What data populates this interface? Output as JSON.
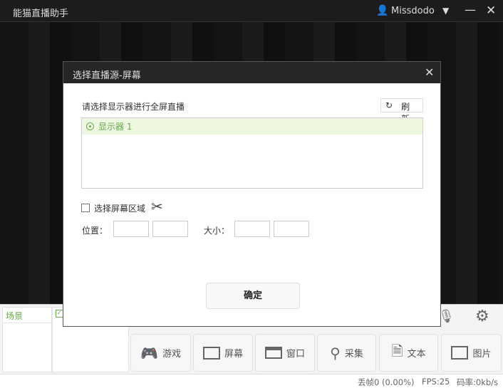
{
  "app": {
    "title": "能猫直播助手",
    "username": "Missdodo"
  },
  "scenes": {
    "header": "场景"
  },
  "sources": [
    {
      "label": "游戏",
      "icon": "gamepad-icon"
    },
    {
      "label": "屏幕",
      "icon": "monitor-icon"
    },
    {
      "label": "窗口",
      "icon": "window-icon"
    },
    {
      "label": "采集",
      "icon": "location-pin-icon"
    },
    {
      "label": "文本",
      "icon": "document-icon"
    },
    {
      "label": "图片",
      "icon": "image-icon"
    }
  ],
  "status": {
    "dropped": "丢帧0 (0.00%)",
    "fps": "FPS:25",
    "bitrate": "码率:0kb/s"
  },
  "dialog": {
    "title": "选择直播源-屏幕",
    "prompt": "请选择显示器进行全屏直播",
    "refresh": "刷新",
    "displays": [
      "显示器 1"
    ],
    "region_label": "选择屏幕区域",
    "position_label": "位置：",
    "size_label": "大小：",
    "confirm": "确定"
  },
  "colors": {
    "accent": "#6aa84f",
    "selected_row": "#eef8e0"
  }
}
